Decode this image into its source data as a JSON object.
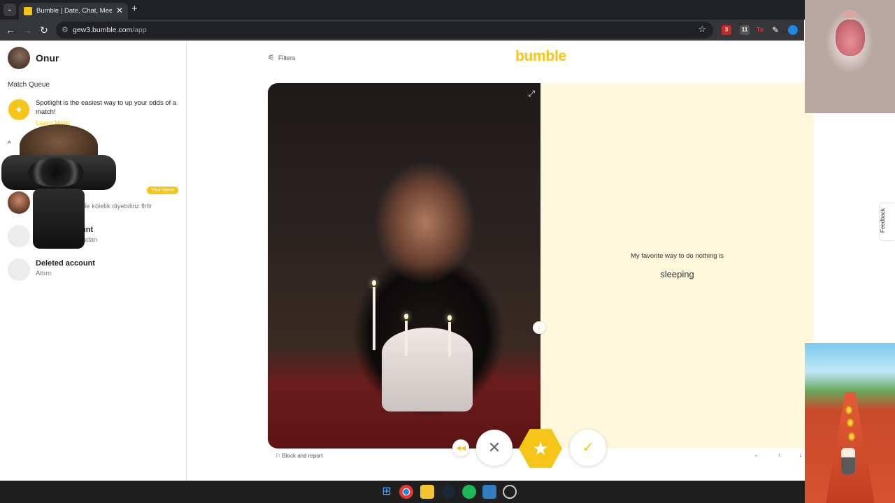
{
  "browser": {
    "tab_title": "Bumble | Date, Chat, Meet New",
    "url_host": "gew3.bumble.com",
    "url_path": "/app",
    "ext_badges": [
      "3",
      "11"
    ],
    "ext_tp_label": "Tp"
  },
  "sidebar": {
    "user_name": "Onur",
    "match_queue_title": "Match Queue",
    "spotlight_text": "Spotlight is the easiest way to up your odds of a match!",
    "learn_more": "Learn More",
    "conversations": [
      {
        "name": "",
        "message": "de kölelik diyebiliriz flrllr",
        "badge": "Your move"
      },
      {
        "name": "unt",
        "message": "adan"
      },
      {
        "name": "Deleted account",
        "message": "Attım"
      }
    ]
  },
  "main": {
    "filters_label": "Filters",
    "logo": "bumble",
    "prompt_question": "My favorite way to do nothing is",
    "prompt_answer": "sleeping",
    "block_report": "Block and report",
    "keyboard_hints": "← ↑ ↓ →",
    "feedback": "Feedback"
  },
  "colors": {
    "brand_yellow": "#f5c518",
    "about_bg": "#fff8dc"
  },
  "icons": {
    "filters": "sliders-icon",
    "expand": "expand-icon",
    "rewind": "rewind-icon",
    "pass": "close-icon",
    "superswipe": "star-icon",
    "like": "check-icon"
  }
}
